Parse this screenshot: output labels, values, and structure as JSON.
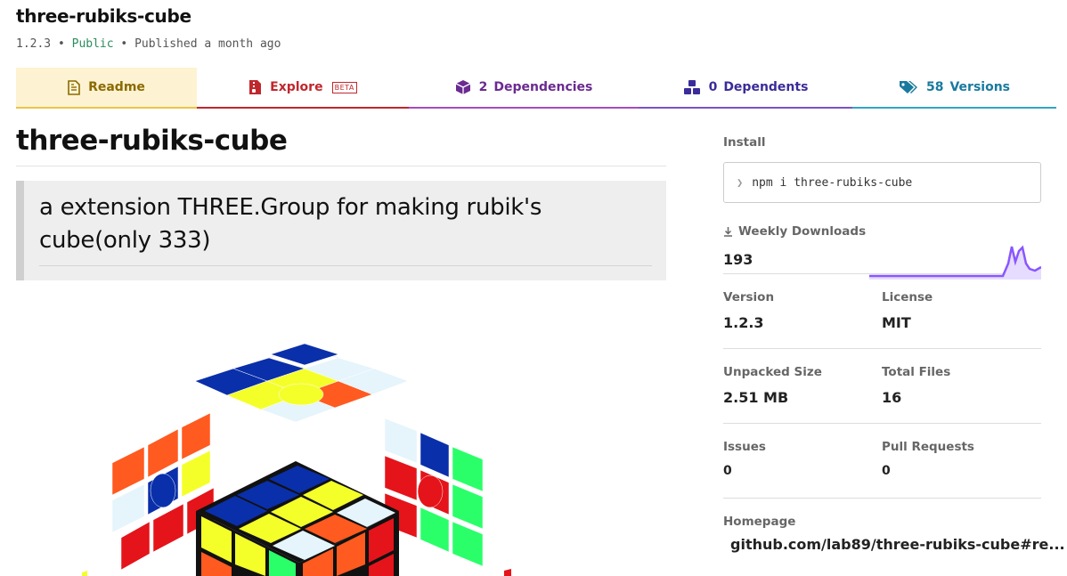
{
  "package": {
    "name": "three-rubiks-cube",
    "version": "1.2.3",
    "visibility": "Public",
    "published": "Published a month ago"
  },
  "tabs": {
    "readme": {
      "label": "Readme",
      "icon": "file-text-icon",
      "color": "#8b6a00"
    },
    "explore": {
      "label": "Explore",
      "badge": "BETA",
      "icon": "file-zip-icon",
      "color": "#c0272d"
    },
    "dependencies": {
      "count": "2",
      "label": "Dependencies",
      "icon": "box-icon",
      "color": "#6b2a91"
    },
    "dependents": {
      "count": "0",
      "label": "Dependents",
      "icon": "boxes-icon",
      "color": "#3a2c9a"
    },
    "versions": {
      "count": "58",
      "label": "Versions",
      "icon": "tags-icon",
      "color": "#197a9e"
    }
  },
  "readme": {
    "title": "three-rubiks-cube",
    "description": "a extension THREE.Group for making rubik's cube(only 333)",
    "image": "rubiks-cube-exploded-view"
  },
  "sidebar": {
    "install_label": "Install",
    "install_command": "npm i three-rubiks-cube",
    "weekly_downloads_label": "Weekly Downloads",
    "weekly_downloads": "193",
    "version_label": "Version",
    "version": "1.2.3",
    "license_label": "License",
    "license": "MIT",
    "unpacked_size_label": "Unpacked Size",
    "unpacked_size": "2.51 MB",
    "total_files_label": "Total Files",
    "total_files": "16",
    "issues_label": "Issues",
    "issues": "0",
    "pull_requests_label": "Pull Requests",
    "pull_requests": "0",
    "homepage_label": "Homepage",
    "homepage": "github.com/lab89/three-rubiks-cube#re..."
  },
  "colors": {
    "accent_public": "#2d8c5f",
    "sparkline": "#8956ff"
  }
}
